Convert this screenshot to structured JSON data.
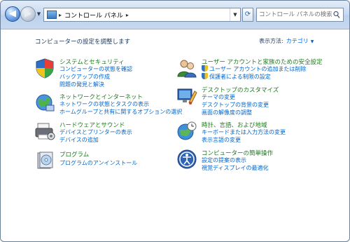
{
  "navbar": {
    "address_path": "コントロール パネル",
    "search_placeholder": "コントロール パネルの検索"
  },
  "page": {
    "title": "コンピューターの設定を調整します",
    "view_by_label": "表示方法:",
    "view_by_value": "カテゴリ"
  },
  "categories": [
    {
      "title": "システムとセキュリティ",
      "links": [
        "コンピューターの状態を確認",
        "バックアップの作成",
        "問題の発見と解決"
      ]
    },
    {
      "title": "ネットワークとインターネット",
      "links": [
        "ネットワークの状態とタスクの表示",
        "ホームグループと共有に関するオプションの選択"
      ]
    },
    {
      "title": "ハードウェアとサウンド",
      "links": [
        "デバイスとプリンターの表示",
        "デバイスの追加"
      ]
    },
    {
      "title": "プログラム",
      "links": [
        "プログラムのアンインストール"
      ]
    },
    {
      "title": "ユーザー アカウントと家族のための安全設定",
      "links": [
        "ユーザー アカウントの追加または削除",
        "保護者による制限の設定"
      ]
    },
    {
      "title": "デスクトップのカスタマイズ",
      "links": [
        "テーマの変更",
        "デスクトップの背景の変更",
        "画面の解像度の調整"
      ]
    },
    {
      "title": "時計、言語、および地域",
      "links": [
        "キーボードまたは入力方法の変更",
        "表示言語の変更"
      ]
    },
    {
      "title": "コンピューターの簡単操作",
      "links": [
        "設定の提案の表示",
        "視覚ディスプレイの最適化"
      ]
    }
  ]
}
